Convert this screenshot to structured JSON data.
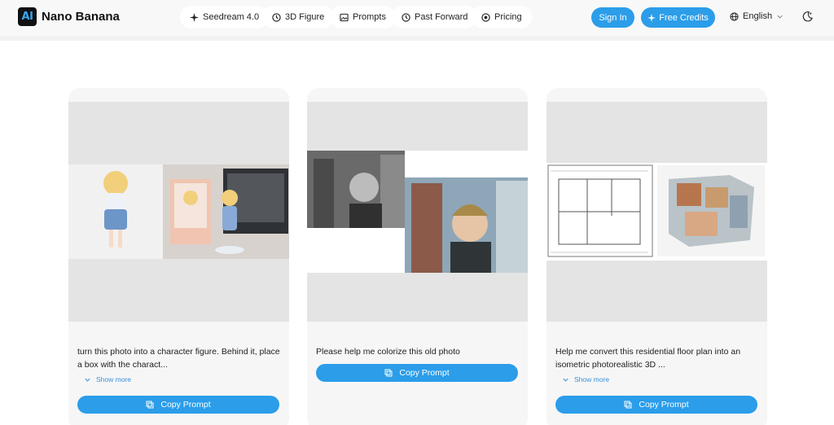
{
  "header": {
    "logo_text": "AI",
    "brand": "Nano Banana",
    "nav": [
      {
        "label": "Seedream 4.0",
        "icon": "sparkle-icon"
      },
      {
        "label": "3D Figure",
        "icon": "clock-icon"
      },
      {
        "label": "Prompts",
        "icon": "image-icon"
      },
      {
        "label": "Past Forward",
        "icon": "clock-icon"
      },
      {
        "label": "Pricing",
        "icon": "coin-icon"
      }
    ],
    "sign_in": "Sign In",
    "free_credits": "Free Credits",
    "language": "English"
  },
  "cards": [
    {
      "prompt": "turn this photo into a character figure. Behind it, place a box with the charact...",
      "show_more": "Show more",
      "copy_label": "Copy Prompt"
    },
    {
      "prompt": "Please help me colorize this old photo",
      "copy_label": "Copy Prompt"
    },
    {
      "prompt": "Help me convert this residential floor plan into an isometric photorealistic 3D ...",
      "show_more": "Show more",
      "copy_label": "Copy Prompt"
    }
  ],
  "colors": {
    "accent": "#2b9de9",
    "page_bg": "#ffffff",
    "card_bg": "#f6f6f7"
  }
}
